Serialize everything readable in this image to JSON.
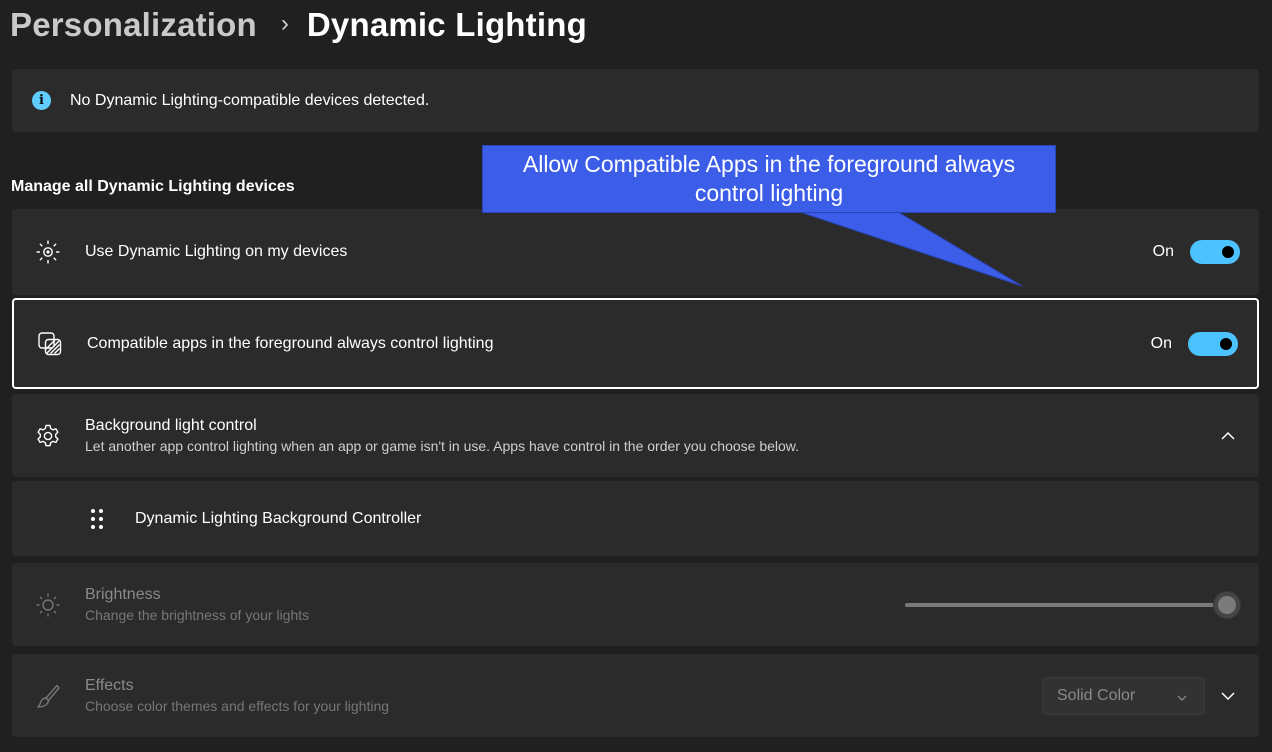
{
  "breadcrumb": {
    "parent": "Personalization",
    "separator": "›",
    "current": "Dynamic Lighting"
  },
  "info": {
    "icon": "info-icon",
    "icon_glyph": "i",
    "text": "No Dynamic Lighting-compatible devices detected."
  },
  "section": {
    "title": "Manage all Dynamic Lighting devices"
  },
  "settings": {
    "use_dynamic_lighting": {
      "icon": "lighting-sun-icon",
      "label": "Use Dynamic Lighting on my devices",
      "state": "On",
      "on": true
    },
    "compatible_apps": {
      "icon": "apps-layers-icon",
      "label": "Compatible apps in the foreground always control lighting",
      "state": "On",
      "on": true
    },
    "background_control": {
      "icon": "gear-icon",
      "title": "Background light control",
      "subtitle": "Let another app control lighting when an app or game isn't in use. Apps have control in the order you choose below.",
      "expanded": true
    },
    "controller_item": {
      "icon": "drag-handle-icon",
      "label": "Dynamic Lighting Background Controller"
    },
    "brightness": {
      "icon": "brightness-icon",
      "title": "Brightness",
      "subtitle": "Change the brightness of your lights",
      "value_percent": 100,
      "disabled": true
    },
    "effects": {
      "icon": "paintbrush-icon",
      "title": "Effects",
      "subtitle": "Choose color themes and effects for your lighting",
      "selected": "Solid Color",
      "disabled": true
    }
  },
  "callout": {
    "text": "Allow Compatible Apps in the foreground always control lighting",
    "color": "#3b5de8"
  },
  "colors": {
    "background": "#202020",
    "card": "#2b2b2b",
    "accent": "#4cc2ff",
    "info": "#60cdff"
  }
}
